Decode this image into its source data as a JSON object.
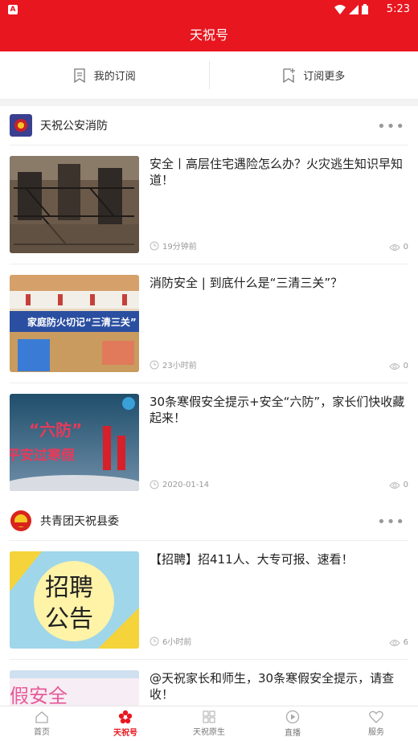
{
  "status": {
    "time": "5:23",
    "app_icon": "A"
  },
  "app": {
    "title": "天祝号"
  },
  "subnav": {
    "my_subs": "我的订阅",
    "more_subs": "订阅更多"
  },
  "accounts": [
    {
      "name": "天祝公安消防",
      "more": "•••",
      "articles": [
        {
          "title": "安全丨高层住宅遇险怎么办？火灾逃生知识早知道！",
          "time": "19分钟前",
          "views": "0"
        },
        {
          "title": "消防安全 | 到底什么是“三清三关”？",
          "time": "23小时前",
          "views": "0",
          "thumb_text": "家庭防火切记“三清三关”"
        },
        {
          "title": "30条寒假安全提示+安全“六防”，家长们快收藏起来！",
          "time": "2020-01-14",
          "views": "0",
          "thumb_text_1": "“六防”",
          "thumb_text_2": "平安过寒假"
        }
      ]
    },
    {
      "name": "共青团天祝县委",
      "more": "•••",
      "articles": [
        {
          "title": "【招聘】招411人、大专可报、速看！",
          "time": "6小时前",
          "views": "6",
          "thumb_text_1": "招聘",
          "thumb_text_2": "公告"
        },
        {
          "title": "@天祝家长和师生，30条寒假安全提示，请查收！",
          "thumb_text": "假安全"
        }
      ]
    }
  ],
  "tabs": [
    {
      "label": "首页",
      "icon": "home-icon"
    },
    {
      "label": "天祝号",
      "icon": "flower-icon"
    },
    {
      "label": "天祝原生",
      "icon": "grid-icon"
    },
    {
      "label": "直播",
      "icon": "play-icon"
    },
    {
      "label": "服务",
      "icon": "heart-icon"
    }
  ],
  "colors": {
    "brand_red": "#e8161f"
  }
}
